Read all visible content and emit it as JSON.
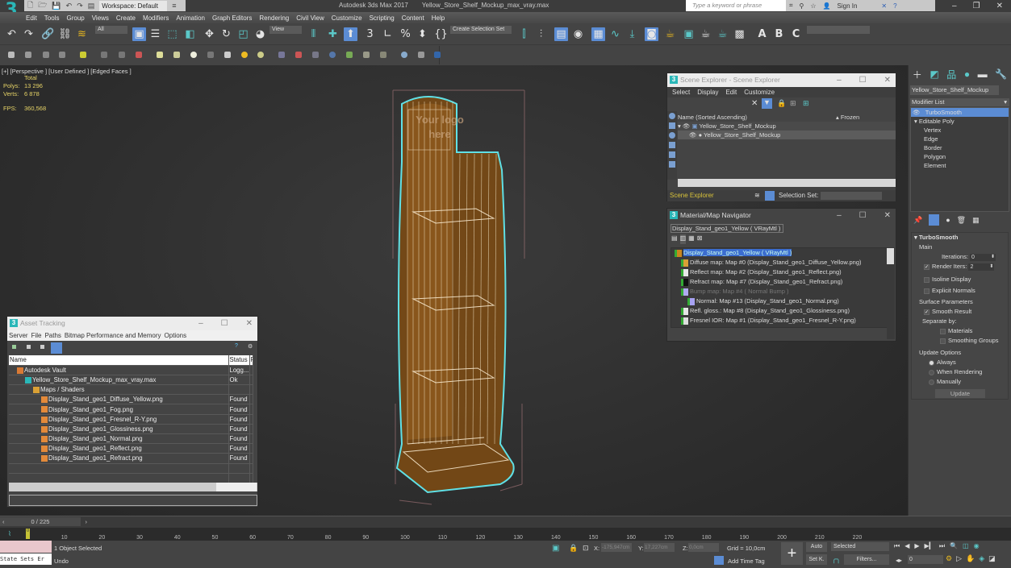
{
  "titlebar": {
    "logo": "3",
    "workspace": "Workspace: Default",
    "app_name": "Autodesk 3ds Max 2017",
    "file_name": "Yellow_Store_Shelf_Mockup_max_vray.max",
    "search_placeholder": "Type a keyword or phrase",
    "sign_in": "Sign In"
  },
  "menu": [
    "Edit",
    "Tools",
    "Group",
    "Views",
    "Create",
    "Modifiers",
    "Animation",
    "Graph Editors",
    "Rendering",
    "Civil View",
    "Customize",
    "Scripting",
    "Content",
    "Help"
  ],
  "toolbar": {
    "selection_filter": "All",
    "ref_coord": "View",
    "selection_set": "Create Selection Set",
    "render_preset": ""
  },
  "viewport": {
    "label": "[+] [Perspective ] [User Defined ] [Edged Faces ]",
    "stats_header": "Total",
    "polys_label": "Polys:",
    "polys": "13 296",
    "verts_label": "Verts:",
    "verts": "6 878",
    "fps_label": "FPS:",
    "fps": "360,568",
    "logo_text_1": "Your logo",
    "logo_text_2": "here"
  },
  "scene_explorer": {
    "title": "Scene Explorer - Scene Explorer",
    "menu": [
      "Select",
      "Display",
      "Edit",
      "Customize"
    ],
    "col_name": "Name (Sorted Ascending)",
    "col_frozen": "▴ Frozen",
    "rows": [
      {
        "name": "Yellow_Store_Shelf_Mockup",
        "level": 0,
        "selected": false
      },
      {
        "name": "Yellow_Store_Shelf_Mockup",
        "level": 1,
        "selected": true
      }
    ],
    "footer_label": "Scene Explorer",
    "selection_set_label": "Selection Set:"
  },
  "material_navigator": {
    "title": "Material/Map Navigator",
    "current": "Display_Stand_geo1_Yellow  ( VRayMtl )",
    "tree": [
      {
        "label": "Display_Stand_geo1_Yellow  ( VRayMtl )",
        "level": 0,
        "selected": true
      },
      {
        "label": "Diffuse map: Map #0 (Display_Stand_geo1_Diffuse_Yellow.png)",
        "level": 1,
        "swatch": "#d9a035"
      },
      {
        "label": "Reflect map: Map #2 (Display_Stand_geo1_Reflect.png)",
        "level": 1,
        "swatch": "#e8e8e8"
      },
      {
        "label": "Refract map: Map #7 (Display_Stand_geo1_Refract.png)",
        "level": 1,
        "swatch": "#111111"
      },
      {
        "label": "Bump map: Map #4  ( Normal Bump )",
        "level": 1,
        "swatch": "#b0aaf0",
        "dim": true
      },
      {
        "label": "Normal: Map #13 (Display_Stand_geo1_Normal.png)",
        "level": 2,
        "swatch": "#a7a2f2"
      },
      {
        "label": "Refl. gloss.: Map #8 (Display_Stand_geo1_Glossiness.png)",
        "level": 1,
        "swatch": "#e5e5e5"
      },
      {
        "label": "Fresnel IOR: Map #1 (Display_Stand_geo1_Fresnel_R-Y.png)",
        "level": 1,
        "swatch": "#dddddd"
      }
    ]
  },
  "asset_tracking": {
    "title": "Asset Tracking",
    "menu": [
      "Server",
      "File",
      "Paths",
      "Bitmap Performance and Memory",
      "Options"
    ],
    "col_name": "Name",
    "col_status": "Status",
    "col_extra": "P",
    "rows": [
      {
        "name": "Autodesk Vault",
        "status": "Logg...",
        "level": 0,
        "icon": "vault"
      },
      {
        "name": "Yellow_Store_Shelf_Mockup_max_vray.max",
        "status": "Ok",
        "level": 1,
        "icon": "max"
      },
      {
        "name": "Maps / Shaders",
        "status": "",
        "level": 2,
        "icon": "folder"
      },
      {
        "name": "Display_Stand_geo1_Diffuse_Yellow.png",
        "status": "Found",
        "level": 3,
        "icon": "image"
      },
      {
        "name": "Display_Stand_geo1_Fog.png",
        "status": "Found",
        "level": 3,
        "icon": "image"
      },
      {
        "name": "Display_Stand_geo1_Fresnel_R-Y.png",
        "status": "Found",
        "level": 3,
        "icon": "image"
      },
      {
        "name": "Display_Stand_geo1_Glossiness.png",
        "status": "Found",
        "level": 3,
        "icon": "image"
      },
      {
        "name": "Display_Stand_geo1_Normal.png",
        "status": "Found",
        "level": 3,
        "icon": "image"
      },
      {
        "name": "Display_Stand_geo1_Reflect.png",
        "status": "Found",
        "level": 3,
        "icon": "image"
      },
      {
        "name": "Display_Stand_geo1_Refract.png",
        "status": "Found",
        "level": 3,
        "icon": "image"
      }
    ]
  },
  "command_panel": {
    "object_name": "Yellow_Store_Shelf_Mockup",
    "modifier_list": "Modifier List",
    "stack": [
      {
        "label": "TurboSmooth",
        "selected": true,
        "level": 0
      },
      {
        "label": "Editable Poly",
        "level": 0,
        "expand": true
      },
      {
        "label": "Vertex",
        "level": 1
      },
      {
        "label": "Edge",
        "level": 1
      },
      {
        "label": "Border",
        "level": 1
      },
      {
        "label": "Polygon",
        "level": 1
      },
      {
        "label": "Element",
        "level": 1
      }
    ],
    "rollout_title": "TurboSmooth",
    "main_label": "Main",
    "iterations_label": "Iterations:",
    "iterations": "0",
    "render_iters_label": "Render Iters:",
    "render_iters": "2",
    "render_iters_checked": true,
    "isoline_label": "Isoline Display",
    "explicit_normals_label": "Explicit Normals",
    "surface_params_label": "Surface Parameters",
    "smooth_result_label": "Smooth Result",
    "separate_by_label": "Separate by:",
    "materials_label": "Materials",
    "smoothing_groups_label": "Smoothing Groups",
    "update_options_label": "Update Options",
    "update_always": "Always",
    "update_when_rendering": "When Rendering",
    "update_manually": "Manually",
    "update_button": "Update"
  },
  "timeline": {
    "slider": "0 / 225",
    "current_frame": "0",
    "ticks": [
      10,
      20,
      30,
      40,
      50,
      60,
      70,
      80,
      90,
      100,
      110,
      120,
      130,
      140,
      150,
      160,
      170,
      180,
      190,
      200,
      210,
      220
    ]
  },
  "status": {
    "script_listener": "State Sets Er",
    "selection": "1 Object Selected",
    "prompt": "Undo",
    "x_label": "X:",
    "x": "-175,947cm",
    "y_label": "Y:",
    "y": "17,227cm",
    "z_label": "Z:",
    "z": "0,0cm",
    "grid": "Grid = 10,0cm",
    "add_time_tag": "Add Time Tag",
    "auto_key": "Auto",
    "set_key": "Set K.",
    "key_filter": "Selected",
    "filters": "Filters...",
    "frame": "0"
  }
}
